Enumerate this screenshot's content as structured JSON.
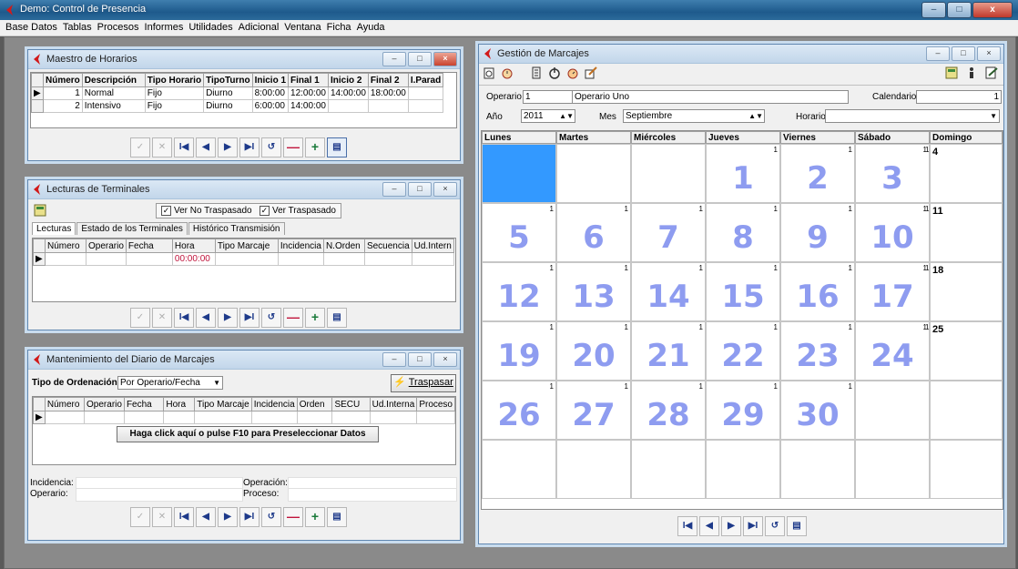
{
  "app": {
    "title": "Demo: Control de Presencia",
    "window_buttons": [
      "–",
      "□",
      "x"
    ]
  },
  "menu": [
    "Base Datos",
    "Tablas",
    "Procesos",
    "Informes",
    "Utilidades",
    "Adicional",
    "Ventana",
    "Ficha",
    "Ayuda"
  ],
  "child_buttons": [
    "–",
    "□",
    "×"
  ],
  "horarios": {
    "title": "Maestro de Horarios",
    "columns": [
      "Número",
      "Descripción",
      "Tipo Horario",
      "TipoTurno",
      "Inicio 1",
      "Final 1",
      "Inicio 2",
      "Final 2",
      "I.Parad"
    ],
    "rows": [
      [
        "1",
        "Normal",
        "Fijo",
        "Diurno",
        "8:00:00",
        "12:00:00",
        "14:00:00",
        "18:00:00",
        ""
      ],
      [
        "2",
        "Intensivo",
        "Fijo",
        "Diurno",
        "6:00:00",
        "14:00:00",
        "",
        "",
        ""
      ]
    ]
  },
  "lecturas": {
    "title": "Lecturas de Terminales",
    "check1": "Ver No Traspasado",
    "check2": "Ver Traspasado",
    "tabs": [
      "Lecturas",
      "Estado de los Terminales",
      "Histórico Transmisión"
    ],
    "columns": [
      "Número",
      "Operario",
      "Fecha",
      "Hora",
      "Tipo Marcaje",
      "Incidencia",
      "N.Orden",
      "Secuencia",
      "Ud.Intern"
    ],
    "row": [
      "",
      "",
      "",
      "00:00:00",
      "",
      "",
      "",
      "",
      ""
    ]
  },
  "diario": {
    "title": "Mantenimiento del Diario de Marcajes",
    "order_label": "Tipo de Ordenación:",
    "order_value": "Por Operario/Fecha",
    "traspasar": "Traspasar",
    "columns": [
      "Número",
      "Operario",
      "Fecha",
      "Hora",
      "Tipo Marcaje",
      "Incidencia",
      "Orden",
      "SECU",
      "Ud.Interna",
      "Proceso"
    ],
    "preselect": "Haga click aquí o pulse F10 para Preseleccionar Datos",
    "incidencia_label": "Incidencia:",
    "operario_label": "Operario:",
    "operacion_label": "Operación:",
    "proceso_label": "Proceso:"
  },
  "gestion": {
    "title": "Gestión de Marcajes",
    "operario_label": "Operario",
    "operario_num": "1",
    "operario_name": "Operario Uno",
    "calendario_label": "Calendario",
    "calendario_value": "1",
    "ano_label": "Año",
    "ano_value": "2011",
    "mes_label": "Mes",
    "mes_value": "Septiembre",
    "horario_label": "Horario",
    "horario_value": ""
  },
  "calendar": {
    "days": [
      "Lunes",
      "Martes",
      "Miércoles",
      "Jueves",
      "Viernes",
      "Sábado",
      "Domingo"
    ],
    "weeks": [
      [
        "",
        "",
        "",
        "1",
        "2",
        "3",
        "4"
      ],
      [
        "5",
        "6",
        "7",
        "8",
        "9",
        "10",
        "11"
      ],
      [
        "12",
        "13",
        "14",
        "15",
        "16",
        "17",
        "18"
      ],
      [
        "19",
        "20",
        "21",
        "22",
        "23",
        "24",
        "25"
      ],
      [
        "26",
        "27",
        "28",
        "29",
        "30",
        "",
        ""
      ],
      [
        "",
        "",
        "",
        "",
        "",
        "",
        ""
      ]
    ],
    "small_marker": "1"
  },
  "nav": {
    "first": "I◀",
    "prev": "◀",
    "next": "▶",
    "last": "▶I",
    "refresh": "↺",
    "delete": "—",
    "add": "+",
    "detail": "▤",
    "confirm": "✓",
    "cancel": "✕"
  },
  "colors": {
    "accent": "#1e5a8c",
    "calendar_number": "#8e9cf0",
    "selected": "#3399ff"
  }
}
